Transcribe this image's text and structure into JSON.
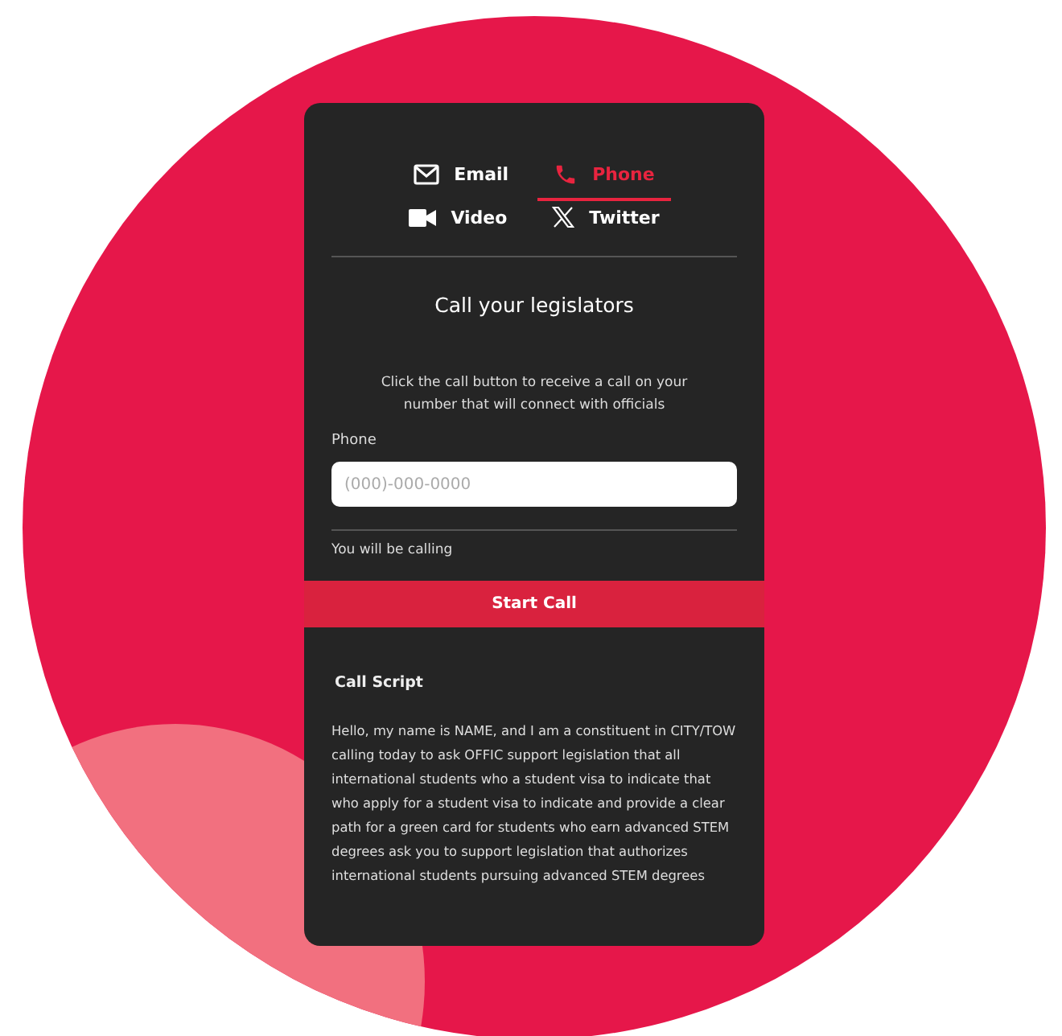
{
  "tabs": [
    {
      "kind": "email",
      "label": "Email",
      "selected": false
    },
    {
      "kind": "phone",
      "label": "Phone",
      "selected": true
    },
    {
      "kind": "video",
      "label": "Video",
      "selected": false
    },
    {
      "kind": "x",
      "label": "Twitter",
      "selected": false
    }
  ],
  "heading": "Call your legislators",
  "description": "Click the call button to receive a call on your number that will connect with officials",
  "phone_field": {
    "label": "Phone",
    "placeholder": "(000)-000-0000"
  },
  "calling_note": "You will be calling",
  "start_button": "Start Call",
  "script": {
    "title": "Call Script",
    "text": "Hello, my name is NAME, and I am a constituent in CITY/TOW calling today to ask OFFIC support legislation that all international students who a student visa to indicate that who apply for a student visa to indicate and provide a clear path for a green card for students who earn advanced STEM degrees ask you to support legislation that authorizes international students pursuing advanced STEM degrees"
  }
}
